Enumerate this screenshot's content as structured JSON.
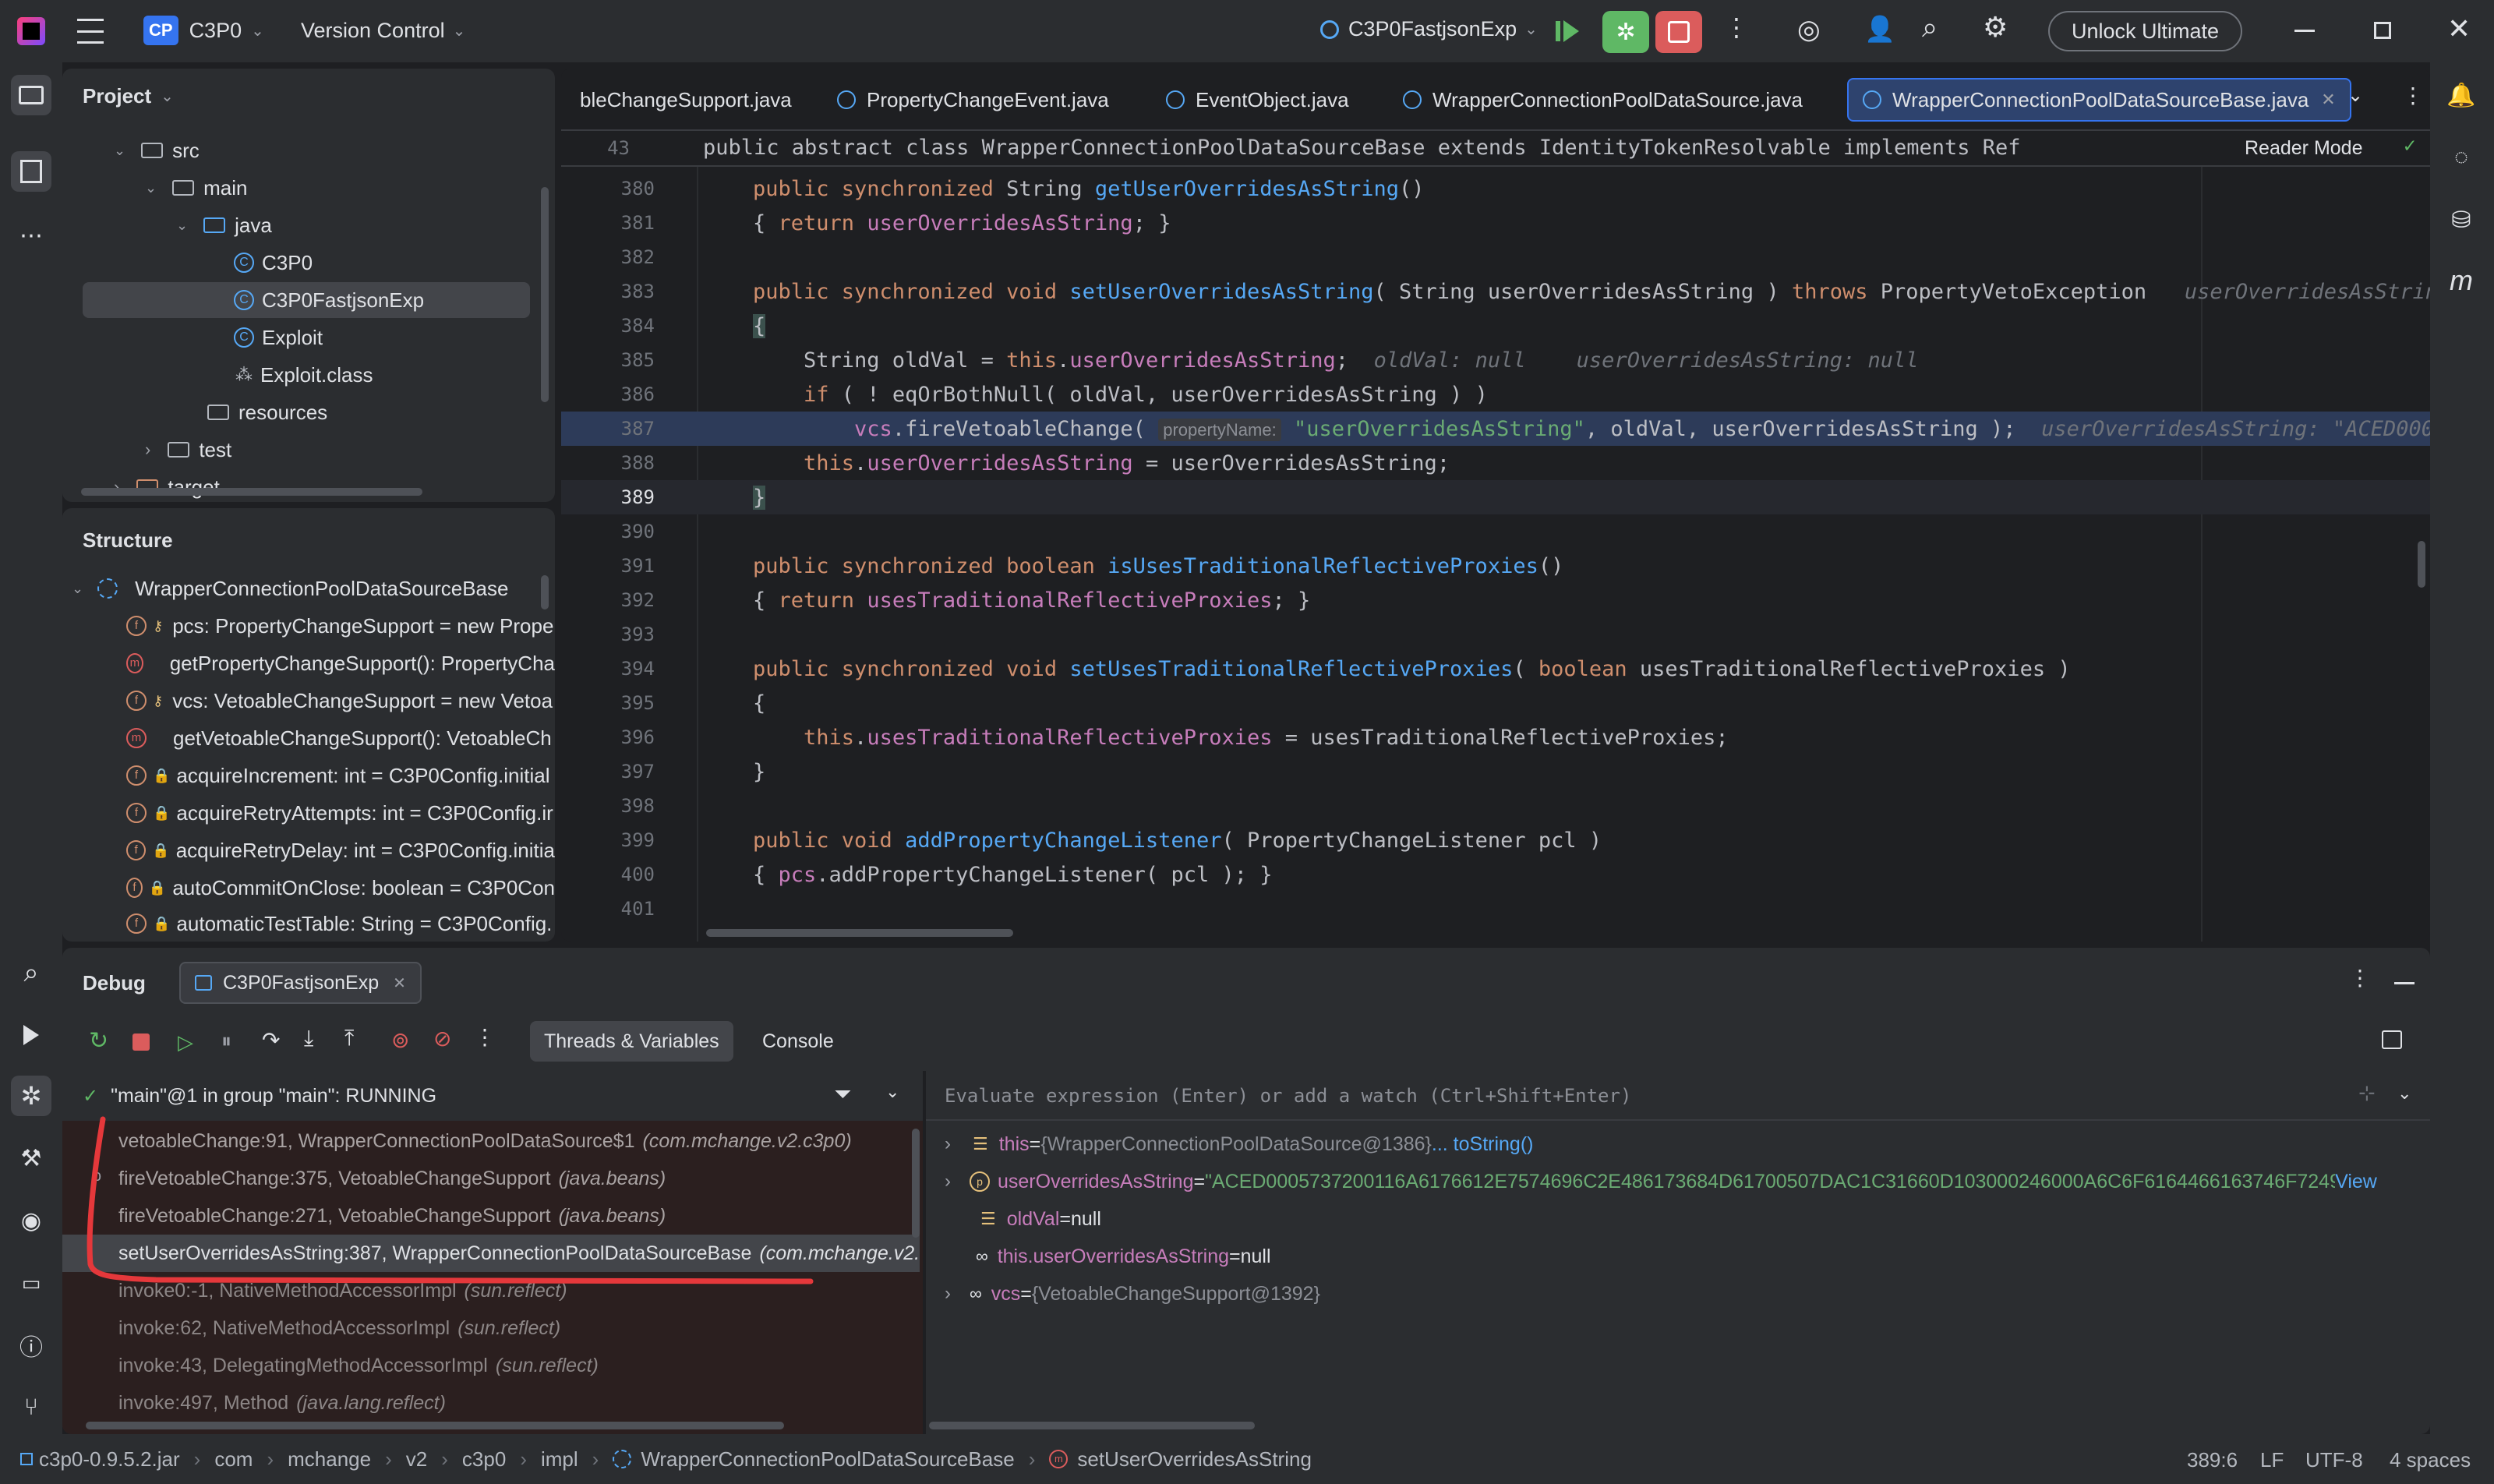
{
  "titlebar": {
    "project_badge": "CP",
    "project_name": "C3P0",
    "vcs_label": "Version Control",
    "run_config": "C3P0FastjsonExp",
    "unlock_label": "Unlock Ultimate"
  },
  "project_panel": {
    "title": "Project",
    "items": [
      {
        "label": "src"
      },
      {
        "label": "main"
      },
      {
        "label": "java"
      },
      {
        "label": "C3P0"
      },
      {
        "label": "C3P0FastjsonExp"
      },
      {
        "label": "Exploit"
      },
      {
        "label": "Exploit.class"
      },
      {
        "label": "resources"
      },
      {
        "label": "test"
      },
      {
        "label": "target"
      }
    ]
  },
  "structure_panel": {
    "title": "Structure",
    "root": "WrapperConnectionPoolDataSourceBase",
    "items": [
      {
        "badge": "f",
        "label": "pcs: PropertyChangeSupport = new Prope"
      },
      {
        "badge": "m",
        "label": "getPropertyChangeSupport(): PropertyCha"
      },
      {
        "badge": "f",
        "label": "vcs: VetoableChangeSupport = new Vetoa"
      },
      {
        "badge": "m",
        "label": "getVetoableChangeSupport(): VetoableCh"
      },
      {
        "badge": "f",
        "label": "acquireIncrement: int = C3P0Config.initial"
      },
      {
        "badge": "f",
        "label": "acquireRetryAttempts: int = C3P0Config.ir"
      },
      {
        "badge": "f",
        "label": "acquireRetryDelay: int = C3P0Config.initia"
      },
      {
        "badge": "f",
        "label": "autoCommitOnClose: boolean = C3P0Con"
      },
      {
        "badge": "f",
        "label": "automaticTestTable: String = C3P0Config."
      }
    ]
  },
  "editor": {
    "tabs": [
      {
        "label": "bleChangeSupport.java"
      },
      {
        "label": "PropertyChangeEvent.java"
      },
      {
        "label": "EventObject.java"
      },
      {
        "label": "WrapperConnectionPoolDataSource.java"
      },
      {
        "label": "WrapperConnectionPoolDataSourceBase.java"
      }
    ],
    "sticky_line_no": "43",
    "sticky_header": "public abstract class WrapperConnectionPoolDataSourceBase extends IdentityTokenResolvable implements Referenceable, Seria",
    "reader_mode": "Reader Mode",
    "line_numbers": [
      "380",
      "381",
      "382",
      "383",
      "384",
      "385",
      "386",
      "387",
      "388",
      "389",
      "390",
      "391",
      "392",
      "393",
      "394",
      "395",
      "396",
      "397",
      "398",
      "399",
      "400",
      "401"
    ],
    "inlay_383": "userOverridesAsString",
    "inlay_385a": "oldVal: null",
    "inlay_385b": "userOverridesAsString: null",
    "param_hint": "propertyName:",
    "inlay_387": "userOverridesAsString: \"ACED000"
  },
  "debug": {
    "title": "Debug",
    "session": "C3P0FastjsonExp",
    "tab_threads": "Threads & Variables",
    "tab_console": "Console",
    "thread_status": "\"main\"@1 in group \"main\": RUNNING",
    "eval_placeholder": "Evaluate expression (Enter) or add a watch (Ctrl+Shift+Enter)",
    "frames": [
      {
        "method": "vetoableChange:91, WrapperConnectionPoolDataSource$1",
        "pkg": "(com.mchange.v2.c3p0)"
      },
      {
        "method": "fireVetoableChange:375, VetoableChangeSupport",
        "pkg": "(java.beans)"
      },
      {
        "method": "fireVetoableChange:271, VetoableChangeSupport",
        "pkg": "(java.beans)"
      },
      {
        "method": "setUserOverridesAsString:387, WrapperConnectionPoolDataSourceBase",
        "pkg": "(com.mchange.v2."
      },
      {
        "method": "invoke0:-1, NativeMethodAccessorImpl",
        "pkg": "(sun.reflect)"
      },
      {
        "method": "invoke:62, NativeMethodAccessorImpl",
        "pkg": "(sun.reflect)"
      },
      {
        "method": "invoke:43, DelegatingMethodAccessorImpl",
        "pkg": "(sun.reflect)"
      },
      {
        "method": "invoke:497, Method",
        "pkg": "(java.lang.reflect)"
      }
    ],
    "variables": [
      {
        "name": "this",
        "eq": " = ",
        "value": "{WrapperConnectionPoolDataSource@1386}",
        "extra": " ... toString()"
      },
      {
        "name": "userOverridesAsString",
        "eq": " = ",
        "value": "\"ACED0005737200116A6176612E7574696C2E486173684D61700507DAC1C31660D103000246000A6C6F6164466163746F7249(...",
        "extra": " View"
      },
      {
        "name": "oldVal",
        "eq": " = ",
        "value": "null",
        "extra": ""
      },
      {
        "name": "this.userOverridesAsString",
        "eq": " = ",
        "value": "null",
        "extra": ""
      },
      {
        "name": "vcs",
        "eq": " = ",
        "value": "{VetoableChangeSupport@1392}",
        "extra": ""
      }
    ]
  },
  "statusbar": {
    "crumbs": [
      "c3p0-0.9.5.2.jar",
      "com",
      "mchange",
      "v2",
      "c3p0",
      "impl",
      "WrapperConnectionPoolDataSourceBase",
      "setUserOverridesAsString"
    ],
    "position": "389:6",
    "line_sep": "LF",
    "encoding": "UTF-8",
    "indent": "4 spaces"
  },
  "colors": {
    "accent": "#3574f0",
    "keyword": "#cf8e6d",
    "function": "#56a8f5",
    "field": "#c77dbb",
    "string": "#6aab73",
    "annotation_red": "#e5383b"
  }
}
